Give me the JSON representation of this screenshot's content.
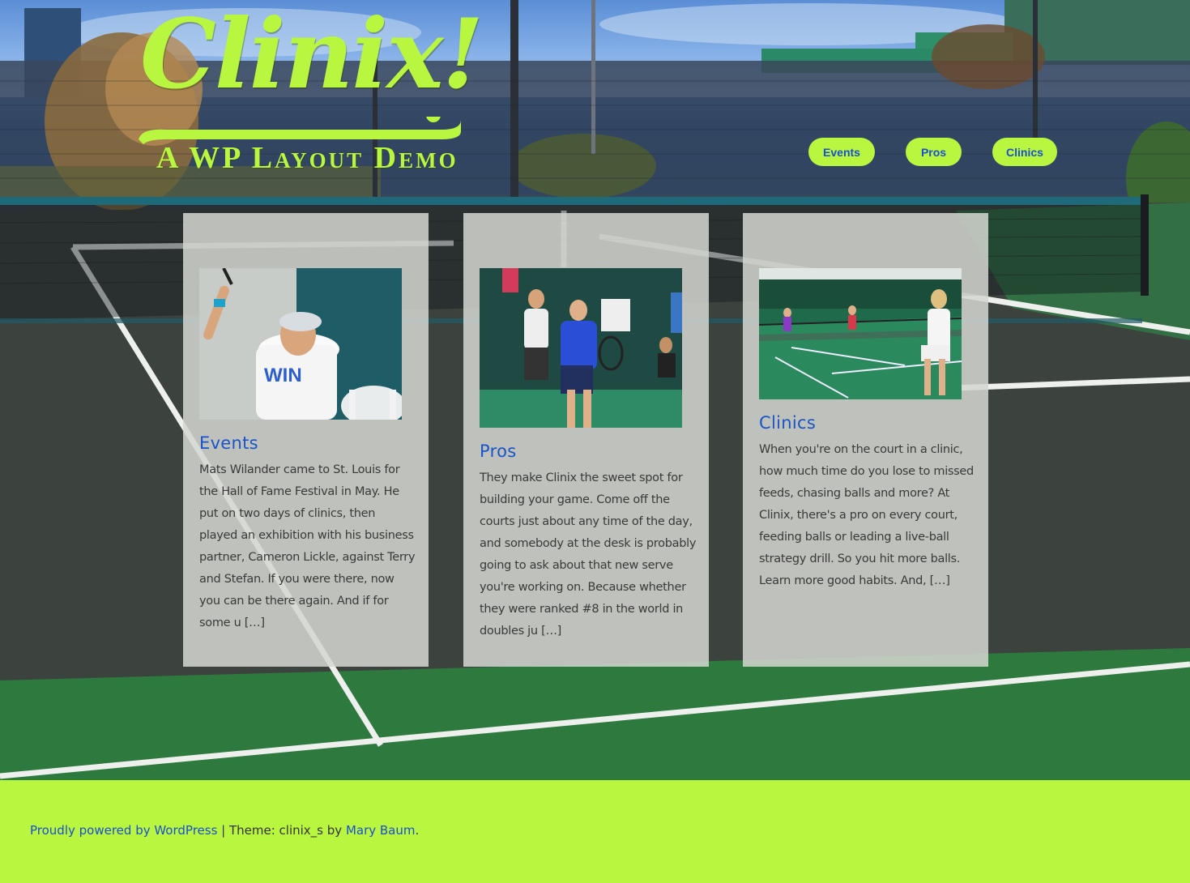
{
  "branding": {
    "logo_word": "Clinix!",
    "tagline": "A WP Layout Demo",
    "accent_color": "#b9f63f",
    "link_color": "#1a4fd0"
  },
  "nav": {
    "items": [
      {
        "label": "Events"
      },
      {
        "label": "Pros"
      },
      {
        "label": "Clinics"
      }
    ]
  },
  "posts": [
    {
      "title": "Events",
      "excerpt": "Mats Wilander came to St. Louis for the Hall of Fame Festival in May. He put on two days of clinics, then played an exhibition with his business partner, Cameron Lickle, against Terry and Stefan. If you were there, now you can be there again. And if for some u […]",
      "image_icon": "tennis-player-photo"
    },
    {
      "title": "Pros",
      "excerpt": "They make Clinix the sweet spot for building your game. Come off the courts just about any time of the day, and somebody at the desk is probably going to ask about that new serve you're working on. Because whether they were ranked #8 in the world in doubles ju […]",
      "image_icon": "doubles-match-photo"
    },
    {
      "title": "Clinics",
      "excerpt": "When you're on the court in a clinic, how much time do you lose to missed feeds, chasing balls and more? At Clinix, there's a pro on every court, feeding balls or leading a live-ball strategy drill. So you hit more balls. Learn more good habits. And, […]",
      "image_icon": "indoor-court-photo"
    }
  ],
  "footer": {
    "powered_by": "Proudly powered by WordPress",
    "separator": " | Theme: clinix_s by ",
    "author": "Mary Baum",
    "trailing": "."
  }
}
